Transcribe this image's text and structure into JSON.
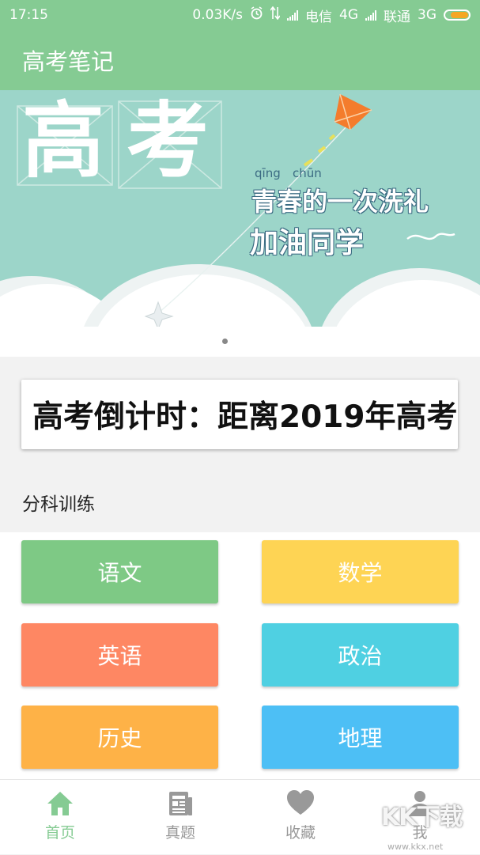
{
  "status_bar": {
    "time": "17:15",
    "speed": "0.03K/s",
    "carrier1": "电信",
    "network1": "4G",
    "carrier2": "联通",
    "network2": "3G",
    "icons": [
      "alarm-icon",
      "data-transfer-icon",
      "signal-icon",
      "battery-icon"
    ]
  },
  "app_bar": {
    "title": "高考笔记"
  },
  "banner": {
    "big_text": [
      "高",
      "考"
    ],
    "pinyin": [
      "qīng",
      "chūn"
    ],
    "line1": "青春的一次洗礼",
    "line2": "加油同学",
    "colors": {
      "background": "#9cd5c9",
      "kite": "#f47c2c",
      "text_dark": "#3a6a82"
    }
  },
  "countdown": {
    "text": "高考倒计时：距离2019年高考"
  },
  "section": {
    "title": "分科训练"
  },
  "subjects": [
    {
      "label": "语文",
      "color": "#7ec985"
    },
    {
      "label": "数学",
      "color": "#fed454"
    },
    {
      "label": "英语",
      "color": "#fe8763"
    },
    {
      "label": "政治",
      "color": "#4fd0e2"
    },
    {
      "label": "历史",
      "color": "#feb247"
    },
    {
      "label": "地理",
      "color": "#4dbff5"
    }
  ],
  "bottom_nav": [
    {
      "label": "首页",
      "icon": "home-icon",
      "active": true
    },
    {
      "label": "真题",
      "icon": "news-icon",
      "active": false
    },
    {
      "label": "收藏",
      "icon": "heart-icon",
      "active": false
    },
    {
      "label": "我",
      "icon": "person-icon",
      "active": false
    }
  ],
  "watermark": {
    "logo": "KK下载",
    "url": "www.kkx.net"
  },
  "theme": {
    "primary": "#85cb93",
    "inactive": "#999999"
  }
}
